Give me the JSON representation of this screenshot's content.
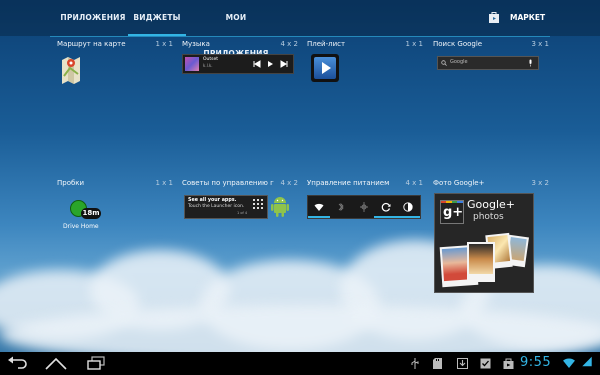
{
  "tabs": [
    {
      "label": "ПРИЛОЖЕНИЯ",
      "active": false
    },
    {
      "label": "ВИДЖЕТЫ",
      "active": true
    },
    {
      "label": "МОИ ПРИЛОЖЕНИЯ",
      "active": false
    }
  ],
  "market_label": "МАРКЕТ",
  "widgets": [
    {
      "title": "Маршрут на карте",
      "size": "1 x 1"
    },
    {
      "title": "Музыка",
      "size": "4 x 2"
    },
    {
      "title": "Плей-лист",
      "size": "1 x 1"
    },
    {
      "title": "Поиск Google",
      "size": "3 x 1"
    },
    {
      "title": "Пробки",
      "size": "1 x 1"
    },
    {
      "title": "Советы по управлению главн",
      "size": "4 x 2"
    },
    {
      "title": "Управление питанием",
      "size": "4 x 1"
    },
    {
      "title": "Фото Google+",
      "size": "3 x 2"
    }
  ],
  "music_preview": {
    "track": "Outset",
    "artist": "k.l.k."
  },
  "search_preview": {
    "placeholder": "Google"
  },
  "traffic_preview": {
    "minutes": "18m",
    "label": "Drive Home"
  },
  "tips_preview": {
    "line1": "See all your apps.",
    "line2": "Touch the Launcher icon.",
    "page": "1 of 4"
  },
  "gplus_preview": {
    "title": "Google+",
    "subtitle": "photos"
  },
  "status": {
    "time": "9:55"
  },
  "colors": {
    "accent": "#33b5e5",
    "navbar": "#000000"
  },
  "icons": [
    "back-icon",
    "home-icon",
    "recent-apps-icon",
    "usb-icon",
    "sd-card-icon",
    "download-done-icon",
    "shopping-bag-icon",
    "wifi-icon",
    "battery-icon"
  ]
}
